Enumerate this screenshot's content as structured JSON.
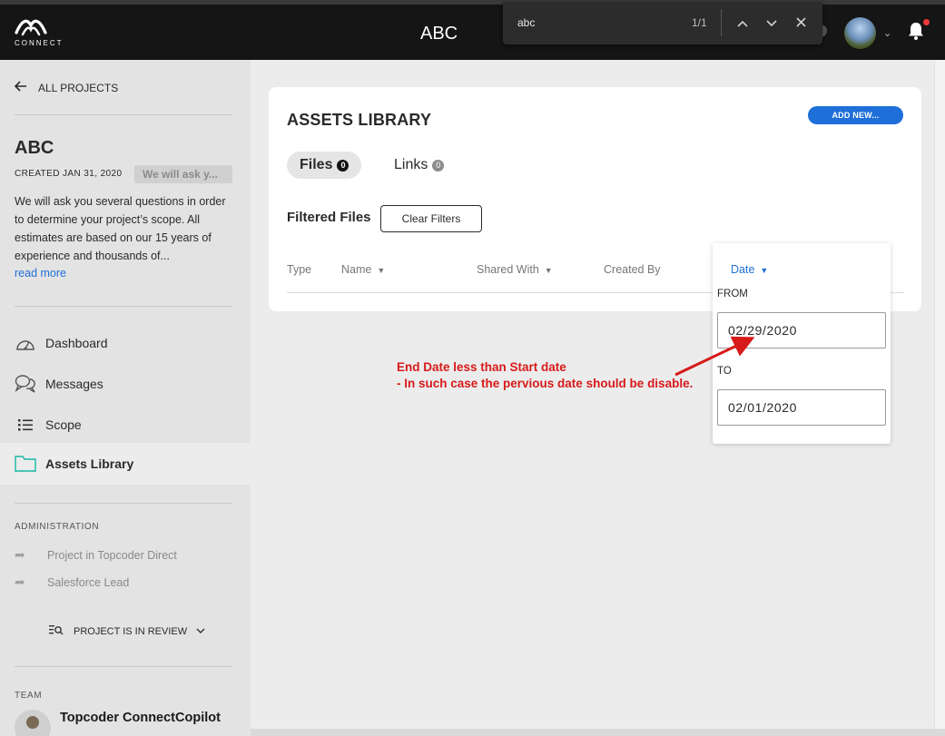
{
  "header": {
    "logo_text": "CONNECT",
    "title": "ABC"
  },
  "findbar": {
    "query": "abc",
    "count": "1/1"
  },
  "sidebar": {
    "back_label": "ALL PROJECTS",
    "project_name": "ABC",
    "created": "CREATED JAN 31, 2020",
    "created_chip": "We will ask y...",
    "description": "We will ask you several questions in order to determine your project’s scope. All estimates are based on our 15 years of experience and thousands of...",
    "read_more": "read more",
    "nav": [
      {
        "label": "Dashboard",
        "icon": "dashboard-icon"
      },
      {
        "label": "Messages",
        "icon": "messages-icon"
      },
      {
        "label": "Scope",
        "icon": "scope-icon"
      },
      {
        "label": "Assets Library",
        "icon": "folder-icon",
        "active": true
      }
    ],
    "admin_label": "ADMINISTRATION",
    "admin_items": [
      "Project in Topcoder Direct",
      "Salesforce Lead"
    ],
    "review_status": "PROJECT IS IN REVIEW",
    "team_label": "TEAM",
    "team_member": "Topcoder ConnectCopilot"
  },
  "assets": {
    "title": "ASSETS LIBRARY",
    "add_new": "ADD NEW...",
    "tabs": [
      {
        "label": "Files",
        "count": "0"
      },
      {
        "label": "Links",
        "count": "0"
      }
    ],
    "filtered_label": "Filtered Files",
    "clear_filters": "Clear Filters",
    "columns": [
      "Type",
      "Name",
      "Shared With",
      "Created By"
    ]
  },
  "date_filter": {
    "header": "Date",
    "from_label": "FROM",
    "from_value": "02/29/2020",
    "to_label": "TO",
    "to_value": "02/01/2020"
  },
  "annotation": {
    "line1": "End Date less than Start date",
    "line2": "- In such case the pervious date should  be disable."
  },
  "colors": {
    "accent": "#1e6fd8",
    "annotation": "#d71a1a",
    "active_folder": "#17b8a1"
  }
}
